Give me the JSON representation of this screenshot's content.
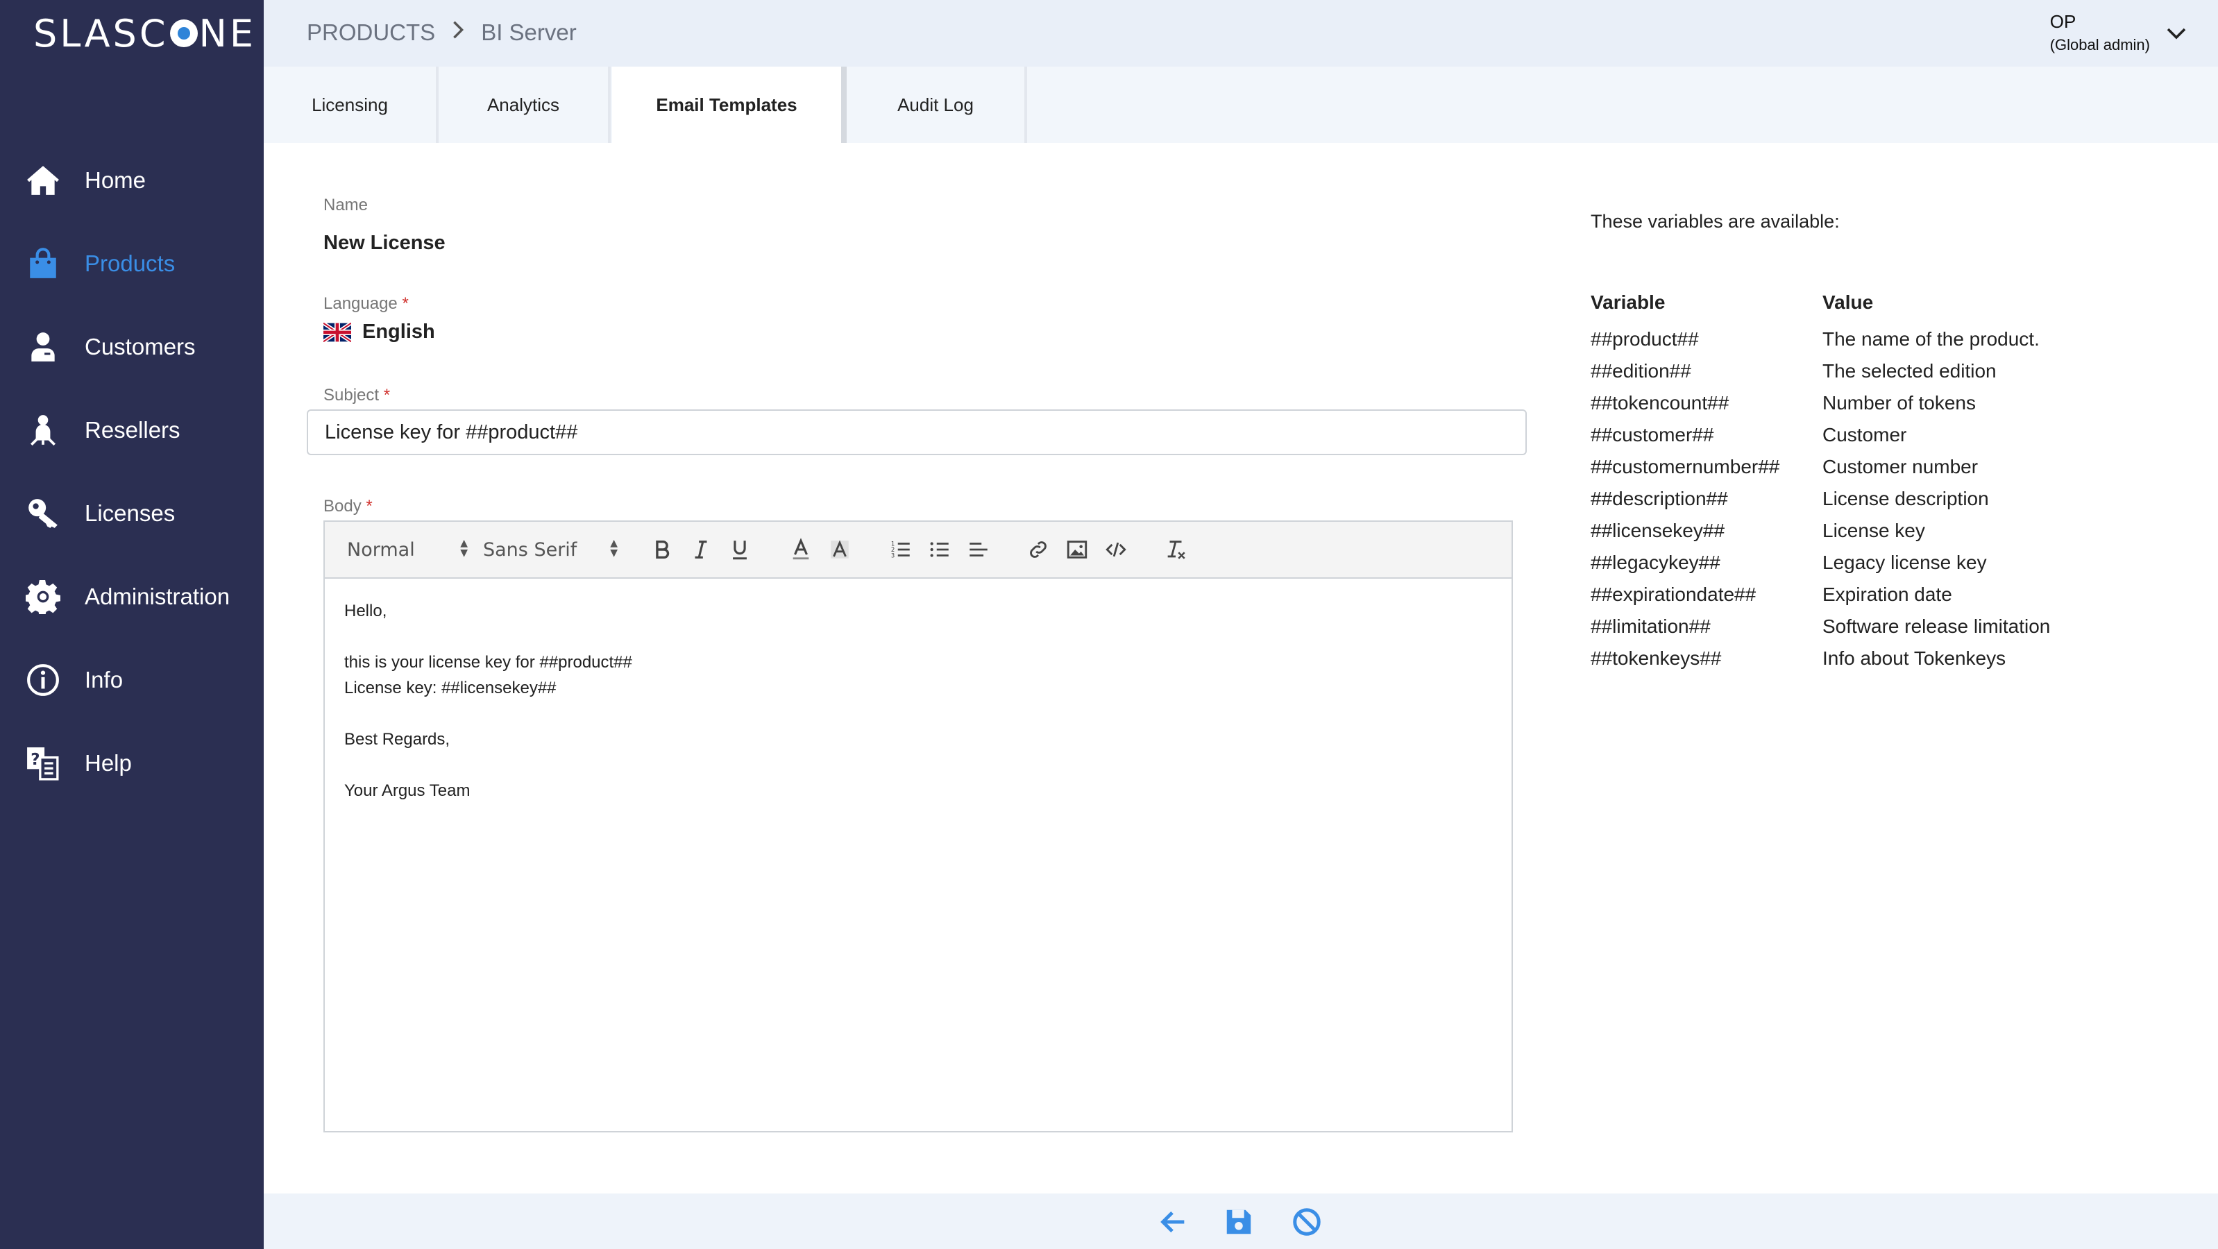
{
  "app": {
    "logo_text_left": "SLASC",
    "logo_text_right": "NE"
  },
  "colors": {
    "sidebar_bg": "#2b2f52",
    "accent": "#3a8ee6",
    "topbar_bg": "#e9eff8",
    "required": "#d0312d"
  },
  "sidebar": {
    "items": [
      {
        "label": "Home",
        "icon": "home-icon"
      },
      {
        "label": "Products",
        "icon": "shopping-bag-icon",
        "active": true
      },
      {
        "label": "Customers",
        "icon": "customer-icon"
      },
      {
        "label": "Resellers",
        "icon": "reseller-icon"
      },
      {
        "label": "Licenses",
        "icon": "key-icon"
      },
      {
        "label": "Administration",
        "icon": "gear-icon"
      },
      {
        "label": "Info",
        "icon": "info-icon"
      },
      {
        "label": "Help",
        "icon": "help-icon"
      }
    ]
  },
  "breadcrumb": {
    "root": "PRODUCTS",
    "current": "BI Server"
  },
  "user": {
    "name": "OP",
    "role": "(Global admin)"
  },
  "tabs": [
    {
      "label": "Licensing"
    },
    {
      "label": "Analytics"
    },
    {
      "label": "Email Templates",
      "active": true
    },
    {
      "label": "Audit Log"
    }
  ],
  "form": {
    "name_label": "Name",
    "name_value": "New License",
    "language_label": "Language",
    "language_value": "English",
    "subject_label": "Subject",
    "subject_value": "License key for ##product##",
    "body_label": "Body",
    "required_mark": "*"
  },
  "editor": {
    "format_select": "Normal",
    "font_select": "Sans Serif",
    "lines": [
      "Hello,",
      "",
      "this is your license key for ##product##",
      "License key: ##licensekey##",
      "",
      "Best Regards,",
      "",
      "Your Argus Team"
    ]
  },
  "variables": {
    "intro": "These variables are available:",
    "col_variable": "Variable",
    "col_value": "Value",
    "rows": [
      {
        "variable": "##product##",
        "value": "The name of the product."
      },
      {
        "variable": "##edition##",
        "value": "The selected edition"
      },
      {
        "variable": "##tokencount##",
        "value": "Number of tokens"
      },
      {
        "variable": "##customer##",
        "value": "Customer"
      },
      {
        "variable": "##customernumber##",
        "value": "Customer number"
      },
      {
        "variable": "##description##",
        "value": "License description"
      },
      {
        "variable": "##licensekey##",
        "value": "License key"
      },
      {
        "variable": "##legacykey##",
        "value": "Legacy license key"
      },
      {
        "variable": "##expirationdate##",
        "value": "Expiration date"
      },
      {
        "variable": "##limitation##",
        "value": "Software release limitation"
      },
      {
        "variable": "##tokenkeys##",
        "value": "Info about Tokenkeys"
      }
    ]
  }
}
